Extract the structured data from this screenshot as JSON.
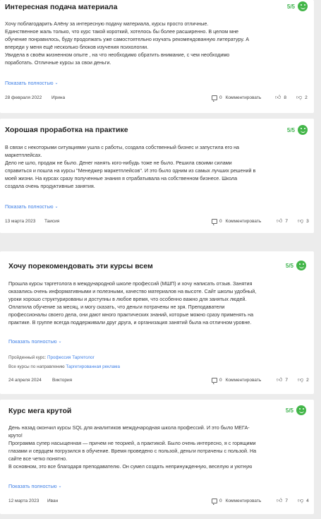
{
  "reviews": [
    {
      "title": "Интересная подача материала",
      "rating": "5/5",
      "paragraphs": [
        "Хочу поблагодарить Алёну за интересную подачу материала, курсы просто отличные.",
        "Единственное жаль только, что курс такой короткий, хотелось бы более расширенно. В целом мне",
        "обучение понравилось, буду продолжать уже самостоятельно изучать рекомендованную литературу. А",
        "впереди у меня ещё несколько блоков изучения психологии.",
        "Увидела в своём жизненном опыте , на что необходимо обратить внимание, с чем необходимо",
        "поработать. Отличные курсы за свои деньги."
      ],
      "show_more": "Показать полностью",
      "date": "28 февраля 2022",
      "author": "Ирина",
      "comments_count": "0",
      "comment_label": "Комментировать",
      "likes": "8",
      "dislikes": "2"
    },
    {
      "title": "Хорошая проработка на практике",
      "rating": "5/5",
      "paragraphs": [
        "В связи с некоторыми ситуациями ушла с работы, создала собственный бизнес и запустила его на",
        "маркетплейсах.",
        "Дело не шло, продаж не было. Денег нанять кого-нибудь тоже не было. Решила своими силами",
        "справиться и пошла на курсы \"Менеджер маркетплейсов\". И это было одним из самых лучших решений в",
        "моей жизни. На курсах сразу полученные знания я отрабатывала на собственном бизнесе. Школа",
        "создала очень продуктивные занятия."
      ],
      "show_more": "Показать полностью",
      "date": "13 марта 2023",
      "author": "Таисия",
      "comments_count": "0",
      "comment_label": "Комментировать",
      "likes": "7",
      "dislikes": "3"
    },
    {
      "title": "Хочу порекомендовать эти курсы всем",
      "rating": "5/5",
      "paragraphs": [
        "Прошла курсы таргетолога в международной школе профессий (МШП) и хочу написать отзыв. Занятия",
        "оказались очень информативными и полезными, качество материалов на высоте. Сайт школы удобный,",
        "уроки хорошо структурированы и доступны в любое время, что особенно важно для занятых людей.",
        "Оплатила обучение за месяц, и могу сказать, что деньги потрачены не зря. Преподаватели",
        "профессионалы своего дела, они дают много практических знаний, которые можно сразу применять на",
        "практике. В группе всегда поддерживали друг друга, и организация занятий была на отличном уровне."
      ],
      "show_more": "Показать полностью",
      "course_label": "Пройденный курс:",
      "course_link": "Профессия Таргетолог",
      "direction_label": "Все курсы по направлению",
      "direction_link": "Таргетированная реклама",
      "date": "24 апреля 2024",
      "author": "Виктория",
      "comments_count": "0",
      "comment_label": "Комментировать",
      "likes": "7",
      "dislikes": "2"
    },
    {
      "title": "Курс мега крутой",
      "rating": "5/5",
      "paragraphs": [
        "День назад окончил курсы SQL для аналитиков международная школа профессий. И это было МЕГА-",
        "круто!",
        "Программа супер насыщенная — причем не теорией, а практикой. Было очень интересно, я с горящими",
        "глазами и сердцем погрузился в обучение. Время проведено с пользой, деньги потрачены с пользой. На",
        "сайте все четко понятно.",
        "В основном, это все благодаря преподавателю. Он сумел создать непринужденную, веселую и уютную"
      ],
      "show_more": "Показать полностью",
      "date": "12 марта 2023",
      "author": "Иван",
      "comments_count": "0",
      "comment_label": "Комментировать",
      "likes": "7",
      "dislikes": "4"
    }
  ],
  "colors": {
    "accent_green": "#43b649",
    "link_blue": "#3d7ee5"
  },
  "icons": {
    "rating": "smile-icon",
    "comment": "comment-icon",
    "like": "thumbs-up-icon",
    "dislike": "thumbs-down-icon",
    "chevron": "chevron-down-icon"
  }
}
